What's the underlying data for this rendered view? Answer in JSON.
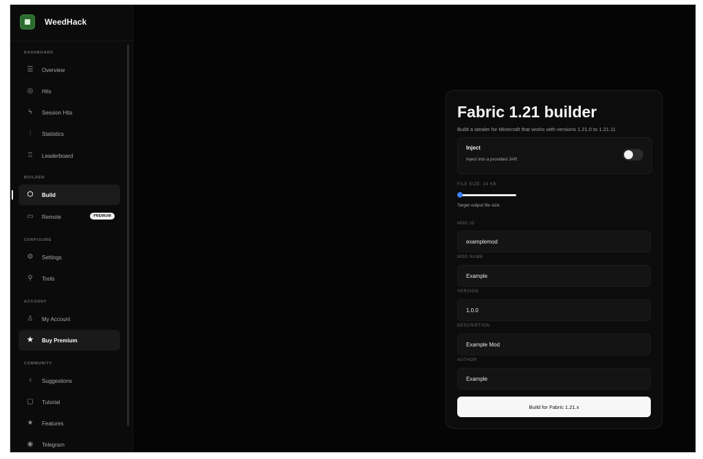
{
  "app": {
    "name": "WeedHack"
  },
  "sidebar": {
    "sections": [
      {
        "title": "DASHBOARD"
      },
      {
        "title": "BUILDER"
      },
      {
        "title": "CONFIGURE"
      },
      {
        "title": "ACCOUNT"
      },
      {
        "title": "COMMUNITY"
      }
    ],
    "items": [
      {
        "label": "Overview",
        "icon": "menu-icon"
      },
      {
        "label": "Hits",
        "icon": "target-icon"
      },
      {
        "label": "Session Hits",
        "icon": "lightning-icon"
      },
      {
        "label": "Statistics",
        "icon": "chart-icon"
      },
      {
        "label": "Leaderboard",
        "icon": "trophy-icon"
      },
      {
        "label": "Build",
        "icon": "cube-icon"
      },
      {
        "label": "Remote",
        "icon": "monitor-icon",
        "badge": "PREMIUM"
      },
      {
        "label": "Settings",
        "icon": "gear-icon"
      },
      {
        "label": "Tools",
        "icon": "wrench-icon"
      },
      {
        "label": "My Account",
        "icon": "user-icon"
      },
      {
        "label": "Buy Premium",
        "icon": "star-icon"
      },
      {
        "label": "Suggestions",
        "icon": "lightbulb-icon"
      },
      {
        "label": "Tutorial",
        "icon": "book-icon"
      },
      {
        "label": "Features",
        "icon": "star-icon"
      },
      {
        "label": "Telegram",
        "icon": "telegram-icon"
      }
    ]
  },
  "builder": {
    "title": "Fabric 1.21 builder",
    "subtitle": "Build a stealer for Minecraft that works with versions 1.21.0 to 1.21.11",
    "inject": {
      "label": "Inject",
      "description": "Inject into a provided JAR.",
      "enabled": false
    },
    "file_size": {
      "label": "FILE SIZE: 24 KB",
      "hint": "Target output file size.",
      "fraction": 0.02
    },
    "fields": [
      {
        "label": "MOD ID",
        "value": "examplemod"
      },
      {
        "label": "MOD NAME",
        "value": "Example"
      },
      {
        "label": "VERSION",
        "value": "1.0.0"
      },
      {
        "label": "DESCRIPTION",
        "value": "Example Mod"
      },
      {
        "label": "AUTHOR",
        "value": "Example"
      }
    ],
    "build_button": "Build for Fabric 1.21.x"
  },
  "colors": {
    "accent": "#3b82f6",
    "brand": "#2c6b2e",
    "background": "#050505"
  }
}
